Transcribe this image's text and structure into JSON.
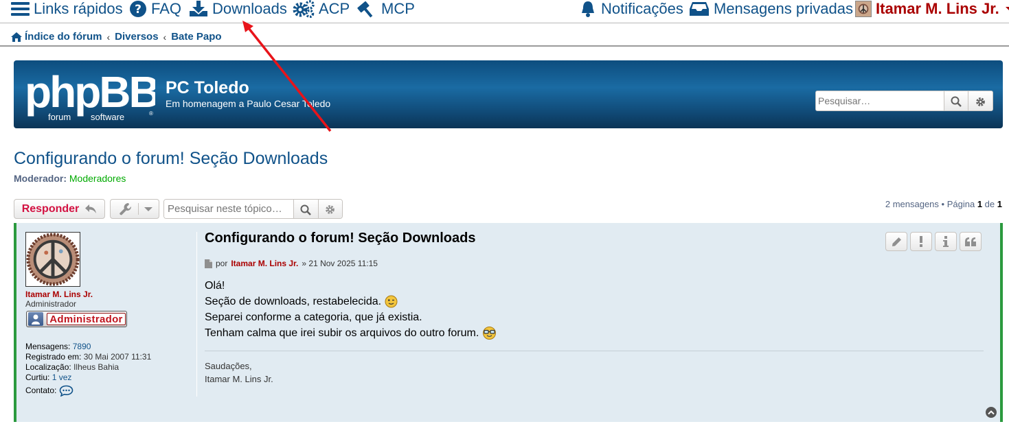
{
  "navbar": {
    "quick_links": "Links rápidos",
    "faq": "FAQ",
    "downloads": "Downloads",
    "acp": "ACP",
    "mcp": "MCP",
    "notifications": "Notificações",
    "private_messages": "Mensagens privadas",
    "username": "Itamar M. Lins Jr."
  },
  "breadcrumbs": [
    "Índice do fórum",
    "Diversos",
    "Bate Papo"
  ],
  "header": {
    "site_title": "PC Toledo",
    "site_description": "Em homenagem a Paulo Cesar Toledo",
    "search_placeholder": "Pesquisar…"
  },
  "topic": {
    "title": "Configurando o forum! Seção Downloads",
    "moderator_label": "Moderador:",
    "moderator_value": "Moderadores"
  },
  "actions": {
    "reply_label": "Responder",
    "topic_search_placeholder": "Pesquisar neste tópico…",
    "pagination_count": "2 mensagens",
    "pagination_page_label": "Página",
    "pagination_current": "1",
    "pagination_of": "de",
    "pagination_total": "1"
  },
  "post": {
    "author": {
      "name": "Itamar M. Lins Jr.",
      "rank": "Administrador",
      "rank_image_text": "Administrador",
      "posts_label": "Mensagens:",
      "posts_value": "7890",
      "joined_label": "Registrado em:",
      "joined_value": "30 Mai 2007 11:31",
      "location_label": "Localização:",
      "location_value": "Ilheus Bahia",
      "likes_label": "Curtiu:",
      "likes_value": "1 vez",
      "contact_label": "Contato:"
    },
    "title": "Configurando o forum! Seção Downloads",
    "by_label": "por",
    "date": "» 21 Nov 2025 11:15",
    "lines": [
      "Olá!",
      "Seção de downloads, restabelecida.",
      "Separei conforme a categoria, que já existia.",
      "Tenham calma que irei subir os arquivos do outro forum."
    ],
    "signature": [
      "Saudações,",
      "Itamar M. Lins Jr."
    ]
  },
  "colors": {
    "link": "#105289",
    "admin": "#aa0000",
    "reply": "#d31141",
    "post_bg": "#e1ebf2",
    "post_border": "#2b9a3e",
    "annotation_arrow": "#e8141a"
  },
  "icons": [
    "hamburger-icon",
    "question-circle-icon",
    "download-icon",
    "cogs-icon",
    "gavel-icon",
    "bell-icon",
    "inbox-icon",
    "home-icon",
    "search-icon",
    "gear-icon",
    "reply-icon",
    "wrench-icon",
    "caret-down-icon",
    "file-icon",
    "chat-bubble-icon",
    "pencil-icon",
    "exclamation-icon",
    "info-icon",
    "quote-icon",
    "chevron-up-icon"
  ]
}
